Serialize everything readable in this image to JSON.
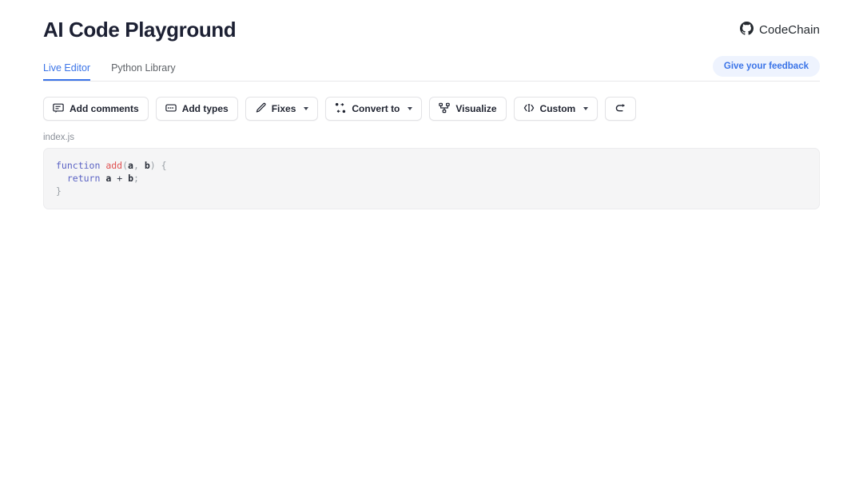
{
  "header": {
    "title": "AI Code Playground",
    "brand": {
      "icon": "github-icon",
      "name": "CodeChain"
    }
  },
  "tabs": [
    {
      "label": "Live Editor",
      "active": true
    },
    {
      "label": "Python Library",
      "active": false
    }
  ],
  "feedback": {
    "label": "Give your feedback"
  },
  "toolbar": [
    {
      "label": "Add comments",
      "icon": "comment-icon",
      "caret": false
    },
    {
      "label": "Add types",
      "icon": "tag-icon",
      "caret": false
    },
    {
      "label": "Fixes",
      "icon": "pencil-icon",
      "caret": true
    },
    {
      "label": "Convert to",
      "icon": "swap-arrows-icon",
      "caret": true
    },
    {
      "label": "Visualize",
      "icon": "node-graph-icon",
      "caret": false
    },
    {
      "label": "Custom",
      "icon": "code-cursor-icon",
      "caret": true
    },
    {
      "label": "",
      "icon": "undo-icon",
      "caret": false
    }
  ],
  "editor": {
    "filename": "index.js",
    "lines": [
      [
        {
          "t": "function",
          "c": "kw"
        },
        {
          "t": " ",
          "c": "op"
        },
        {
          "t": "add",
          "c": "fn"
        },
        {
          "t": "(",
          "c": "pn"
        },
        {
          "t": "a",
          "c": "id"
        },
        {
          "t": ",",
          "c": "pn"
        },
        {
          "t": " ",
          "c": "op"
        },
        {
          "t": "b",
          "c": "id"
        },
        {
          "t": ")",
          "c": "pn"
        },
        {
          "t": " ",
          "c": "op"
        },
        {
          "t": "{",
          "c": "pn"
        }
      ],
      [
        {
          "t": "  ",
          "c": "op"
        },
        {
          "t": "return",
          "c": "kw"
        },
        {
          "t": " ",
          "c": "op"
        },
        {
          "t": "a",
          "c": "id"
        },
        {
          "t": " ",
          "c": "op"
        },
        {
          "t": "+",
          "c": "op"
        },
        {
          "t": " ",
          "c": "op"
        },
        {
          "t": "b",
          "c": "id"
        },
        {
          "t": ";",
          "c": "pn"
        }
      ],
      [
        {
          "t": "}",
          "c": "pn"
        }
      ]
    ]
  },
  "colors": {
    "accent": "#3b74e8",
    "accent_soft": "#eef3fe",
    "title": "#1c2033",
    "panel_bg": "#f5f5f6",
    "panel_border": "#ececee",
    "keyword": "#5b63c4",
    "function": "#e05252",
    "punctuation": "#9aa0a6"
  }
}
